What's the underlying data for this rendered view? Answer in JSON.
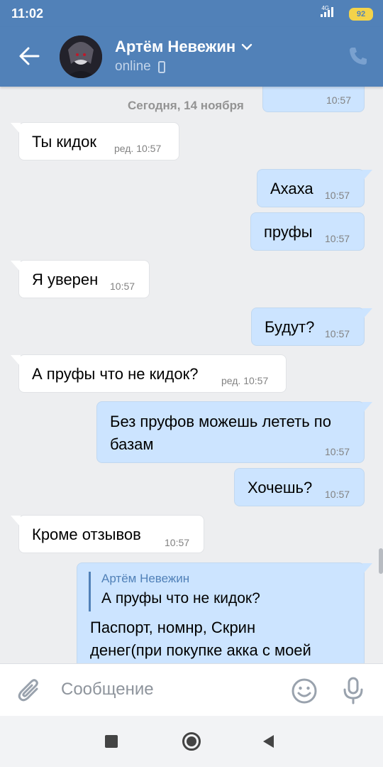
{
  "status_bar": {
    "time": "11:02",
    "network": "4G",
    "battery": "92"
  },
  "header": {
    "name": "Артём Невежин",
    "status": "online"
  },
  "chat": {
    "date_label": "Сегодня, 14 ноября",
    "top_partial_time": "10:57",
    "messages": [
      {
        "dir": "in",
        "text": "Ты кидок",
        "time": "ред. 10:57"
      },
      {
        "dir": "out",
        "text": "Ахаха",
        "time": "10:57"
      },
      {
        "dir": "out",
        "text": "пруфы",
        "time": "10:57"
      },
      {
        "dir": "in",
        "text": "Я уверен",
        "time": "10:57"
      },
      {
        "dir": "out",
        "text": "Будут?",
        "time": "10:57"
      },
      {
        "dir": "in",
        "text": "А пруфы что не кидок?",
        "time": "ред. 10:57"
      },
      {
        "dir": "out",
        "text_line1": "Без пруфов можешь лететь по",
        "text_line2": "базам",
        "time": "10:57"
      },
      {
        "dir": "out",
        "text": "Хочешь?",
        "time": "10:57"
      },
      {
        "dir": "in",
        "text": "Кроме отзывов",
        "time": "10:57"
      },
      {
        "dir": "out",
        "reply_author": "Артём Невежин",
        "reply_text": "А пруфы что не кидок?",
        "text_line1": "Паспорт, номнр, Скрин",
        "text_line2": "денег(при покупке акка с моей"
      }
    ]
  },
  "composer": {
    "placeholder": "Сообщение"
  }
}
